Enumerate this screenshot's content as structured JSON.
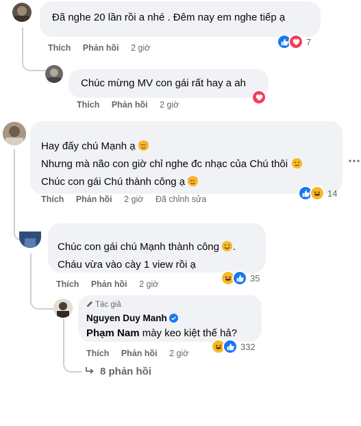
{
  "comments": [
    {
      "text": [
        "Đã nghe 20 lần rồi a nhé . Đêm nay em nghe tiếp ạ"
      ],
      "actions": {
        "like": "Thích",
        "reply": "Phản hồi",
        "time": "2 giờ"
      },
      "reaction_count": "7"
    },
    {
      "text": [
        "Chúc mừng MV con gái rất hay a ah"
      ],
      "actions": {
        "like": "Thích",
        "reply": "Phản hồi",
        "time": "2 giờ"
      }
    },
    {
      "text": [
        "Hay đấy chú Mạnh ạ",
        "Nhưng mà não con giờ chỉ nghe đc nhạc của Chú thôi",
        "Chúc con gái Chú thành công ạ"
      ],
      "actions": {
        "like": "Thích",
        "reply": "Phản hồi",
        "time": "2 giờ",
        "edited": "Đã chỉnh sửa"
      },
      "reaction_count": "14"
    },
    {
      "text": [
        "Chúc con gái chú Mạnh thành công",
        "Cháu vừa vào cày 1 view rồi ạ"
      ],
      "actions": {
        "like": "Thích",
        "reply": "Phản hồi",
        "time": "2 giờ"
      },
      "reaction_count": "35"
    },
    {
      "author_badge": "Tác giả",
      "author": "Nguyen Duy Manh",
      "mention": "Phạm Nam",
      "text": [
        "mày keo kiệt thế hả?"
      ],
      "actions": {
        "like": "Thích",
        "reply": "Phản hồi",
        "time": "2 giờ"
      },
      "reaction_count": "332"
    }
  ],
  "more_replies": "8 phản hồi",
  "icons": {
    "like": "like-icon",
    "love": "love-icon",
    "haha": "haha-icon",
    "heart_eyes": "smiling-hearts-emoji",
    "neutral": "neutral-face-emoji",
    "smile": "smile-emoji",
    "verified": "verified-badge-icon",
    "pencil": "pencil-icon",
    "reply_arrow": "reply-arrow-icon",
    "more": "more-options-icon"
  },
  "colors": {
    "like": "#1877f2",
    "love": "#f33e58",
    "haha": "#f7b928",
    "bubble": "#f0f2f5",
    "meta": "#65676b"
  }
}
